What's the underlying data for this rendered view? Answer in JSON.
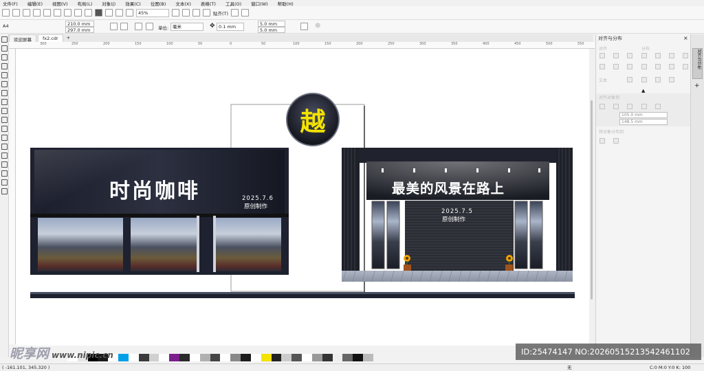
{
  "menu": [
    "文件(F)",
    "编辑(E)",
    "视图(V)",
    "布局(L)",
    "对象(J)",
    "效果(C)",
    "位图(B)",
    "文本(X)",
    "表格(T)",
    "工具(O)",
    "窗口(W)",
    "帮助(H)"
  ],
  "toolbar": {
    "zoom": "45%",
    "snap_label": "贴齐(T)"
  },
  "property_bar": {
    "page_size": "A4",
    "width": "210.0 mm",
    "height": "297.0 mm",
    "units_label": "单位:",
    "units_value": "毫米",
    "nudge": "0.1 mm",
    "dup_x": "5.0 mm",
    "dup_y": "5.0 mm"
  },
  "tabs": [
    {
      "label": "欢迎屏幕"
    },
    {
      "label": "fx2.cdr"
    }
  ],
  "ruler_ticks": [
    "300",
    "250",
    "200",
    "150",
    "100",
    "50",
    "0",
    "50",
    "100",
    "150",
    "200",
    "250",
    "300",
    "350",
    "400",
    "450",
    "500",
    "550"
  ],
  "design": {
    "logo_char": "越",
    "left_sign": "时尚咖啡",
    "left_date": "2025.7.6",
    "left_credit": "原创制作",
    "right_sign": "最美的风景在路上",
    "right_date": "2025.7.5",
    "right_credit": "原创制作"
  },
  "panel": {
    "title": "对齐与分布",
    "align_label": "对齐",
    "distribute_label": "分布",
    "text_label": "文本",
    "align_objects_label": "对齐对象到",
    "x_value": "105.0 mm",
    "y_value": "148.5 mm",
    "distribute_objects_label": "将对象分布到"
  },
  "dock_tab": "对齐与分布",
  "statusbar": {
    "coords": "( -161.101, 345.320 )",
    "fill": "C:0 M:0 Y:0 K: 100",
    "outline": "无"
  },
  "watermark": {
    "text": "昵享网",
    "url": "www.nipic.cn"
  },
  "id_overlay": "ID:25474147 NO:20260515213542461102",
  "colors": {
    "sign_bg": "#1e2130",
    "logo_yellow": "#f4e200",
    "canvas": "#ffffff"
  }
}
